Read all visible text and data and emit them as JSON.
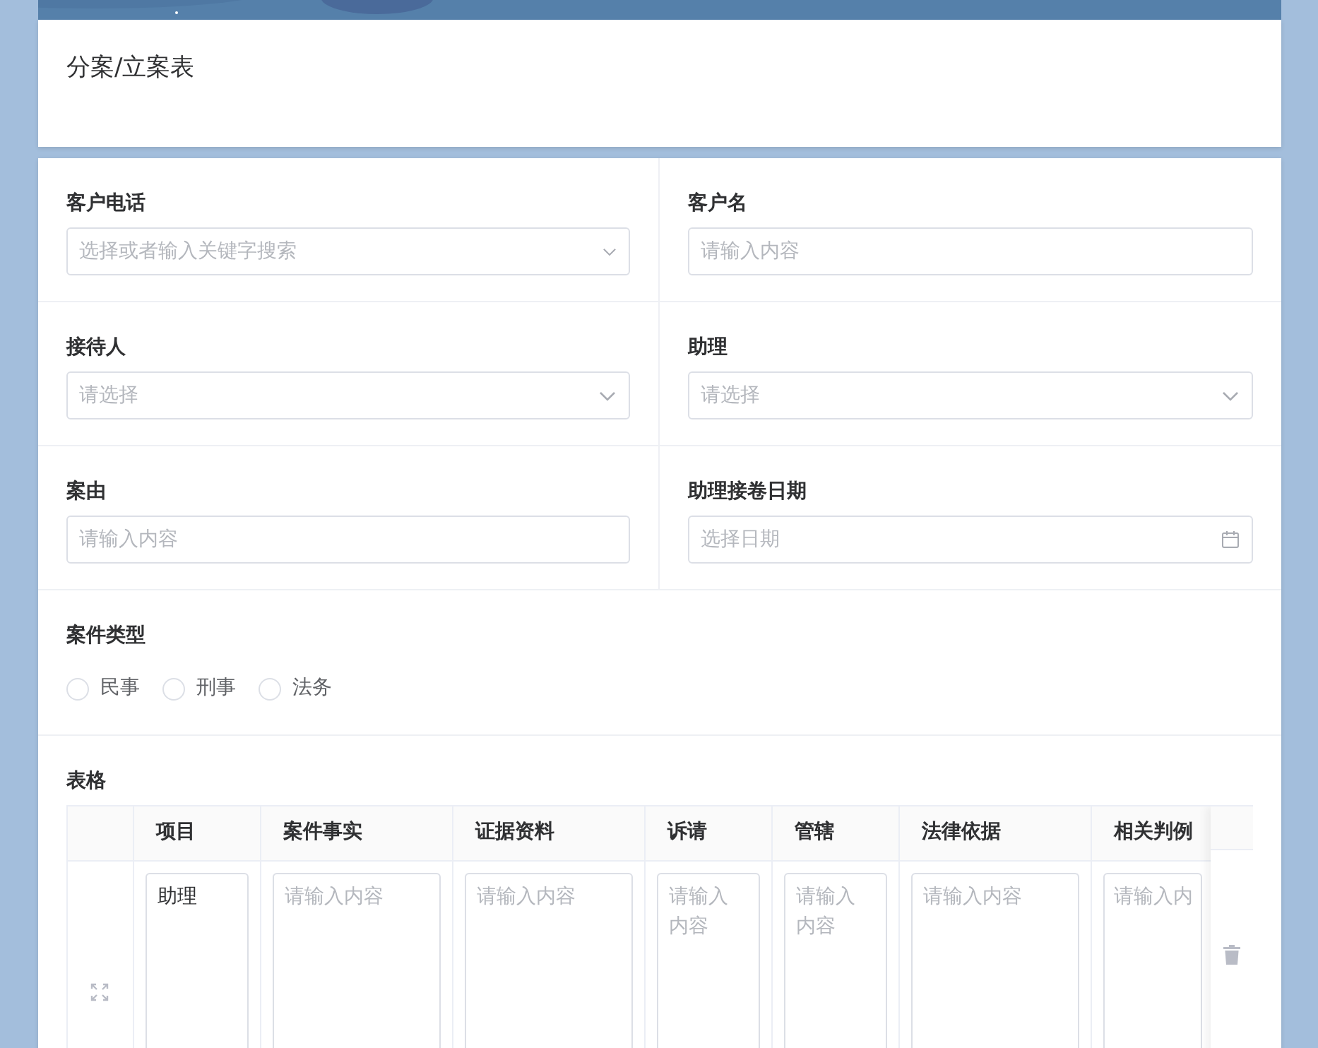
{
  "title": "分案/立案表",
  "fields": [
    {
      "label": "客户电话",
      "kind": "search-select",
      "placeholder": "选择或者输入关键字搜索"
    },
    {
      "label": "客户名",
      "kind": "text",
      "placeholder": "请输入内容"
    },
    {
      "label": "接待人",
      "kind": "select",
      "placeholder": "请选择"
    },
    {
      "label": "助理",
      "kind": "select",
      "placeholder": "请选择"
    },
    {
      "label": "案由",
      "kind": "text",
      "placeholder": "请输入内容"
    },
    {
      "label": "助理接卷日期",
      "kind": "date",
      "placeholder": "选择日期"
    }
  ],
  "case_type": {
    "label": "案件类型",
    "options": [
      {
        "label": "民事",
        "selected": false
      },
      {
        "label": "刑事",
        "selected": false
      },
      {
        "label": "法务",
        "selected": false
      }
    ]
  },
  "table": {
    "label": "表格",
    "columns": [
      "项目",
      "案件事实",
      "证据资料",
      "诉请",
      "管辖",
      "法律依据",
      "相关判例"
    ],
    "rows": [
      {
        "cells": [
          {
            "value": "助理"
          },
          {
            "placeholder": "请输入内容"
          },
          {
            "placeholder": "请输入内容"
          },
          {
            "placeholder": "请输入内容"
          },
          {
            "placeholder": "请输入内容"
          },
          {
            "placeholder": "请输入内容"
          },
          {
            "placeholder": "请输入内"
          }
        ]
      }
    ]
  }
}
